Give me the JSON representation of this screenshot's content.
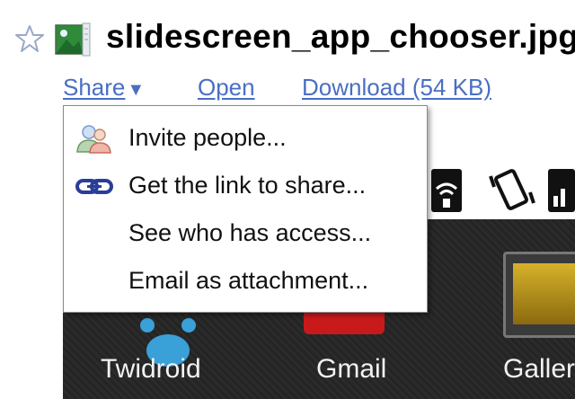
{
  "file": {
    "title": "slidescreen_app_chooser.jpg",
    "star_icon": "star-outline-icon",
    "type_icon": "image-file-icon"
  },
  "actions": {
    "share_label": "Share",
    "share_caret": "▼",
    "open_label": "Open",
    "download_label": "Download (54 KB)"
  },
  "share_menu": {
    "items": [
      {
        "label": "Invite people...",
        "icon": "people-icon"
      },
      {
        "label": "Get the link to share...",
        "icon": "link-icon"
      },
      {
        "label": "See who has access...",
        "icon": ""
      },
      {
        "label": "Email as attachment...",
        "icon": ""
      }
    ]
  },
  "preview": {
    "apps": [
      {
        "label": "Twidroid"
      },
      {
        "label": "Gmail"
      },
      {
        "label": "Galler"
      }
    ]
  }
}
